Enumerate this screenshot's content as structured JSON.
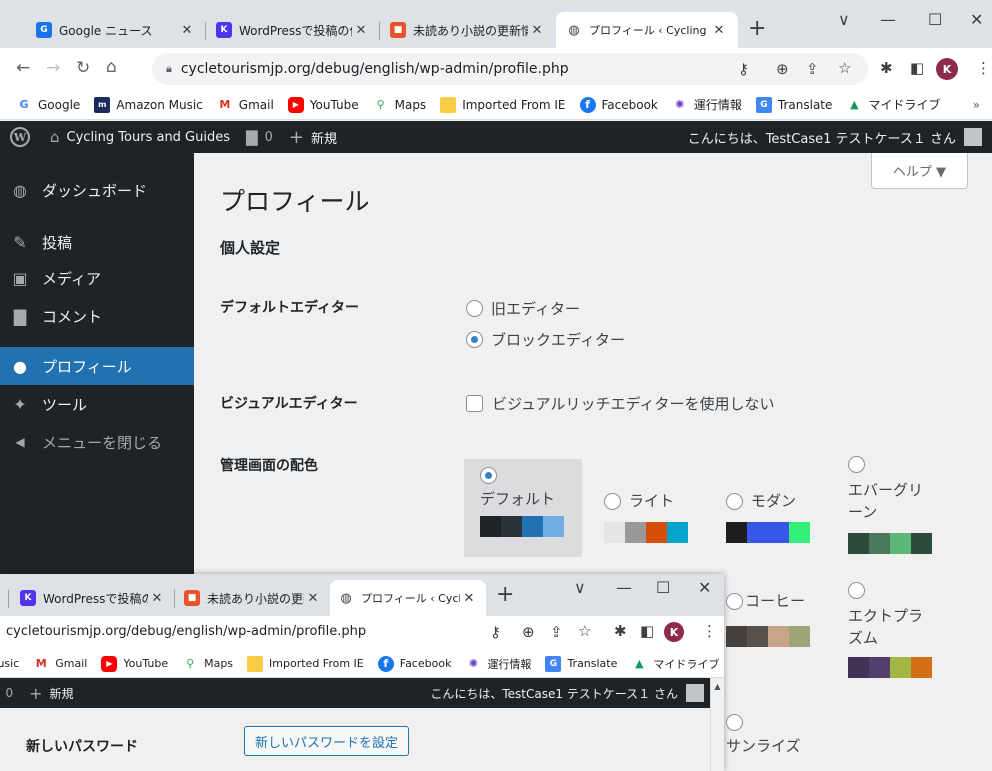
{
  "colors": {
    "brand_blue": "#2271b1",
    "admin_dark": "#1d2327",
    "tab_bg": "#dee1e6"
  },
  "browser": {
    "tabs": [
      {
        "label": "Google ニュース",
        "icon": "google-news-icon",
        "color": "#1a73e8"
      },
      {
        "label": "WordPressで投稿の作",
        "icon": "kinsta-icon",
        "color": "#5333ed"
      },
      {
        "label": "未読あり小説の更新情",
        "icon": "novel-icon",
        "color": "#e8532a"
      },
      {
        "label": "プロフィール ‹ Cycling To",
        "icon": "globe-icon",
        "color": "#3c4043"
      }
    ],
    "new_tab": "+",
    "controls": {
      "menu": "∨",
      "minimize": "—",
      "maximize": "☐",
      "close": "✕"
    },
    "url": "cycletourismjp.org/debug/english/wp-admin/profile.php",
    "profile_initial": "K",
    "bookmarks": [
      {
        "label": "Google",
        "icon": "google-icon",
        "color": "#4285f4"
      },
      {
        "label": "Amazon Music",
        "icon": "amazon-music-icon",
        "color": "#1c2a5e"
      },
      {
        "label": "Gmail",
        "icon": "gmail-icon",
        "color": "#d93025"
      },
      {
        "label": "YouTube",
        "icon": "youtube-icon",
        "color": "#ff0000"
      },
      {
        "label": "Maps",
        "icon": "maps-icon",
        "color": "#34a853"
      },
      {
        "label": "Imported From IE",
        "icon": "folder-icon",
        "color": "#f9cc45"
      },
      {
        "label": "Facebook",
        "icon": "facebook-icon",
        "color": "#1877f2"
      },
      {
        "label": "運行情報",
        "icon": "train-info-icon",
        "color": "#6a3fc8"
      },
      {
        "label": "Translate",
        "icon": "translate-icon",
        "color": "#4285f4"
      },
      {
        "label": "マイドライブ",
        "icon": "google-drive-icon",
        "color": "#0f9d58"
      }
    ],
    "overflow": "»"
  },
  "adminbar": {
    "site_name": "Cycling Tours and Guides",
    "comments_count": "0",
    "new_label": "新規",
    "howdy": "こんにちは、TestCase1 テストケース１ さん"
  },
  "sidebar": {
    "items": [
      {
        "label": "ダッシュボード",
        "icon": "dashboard-icon",
        "glyph": "◍"
      },
      {
        "label": "投稿",
        "icon": "pin-icon",
        "glyph": "✎"
      },
      {
        "label": "メディア",
        "icon": "media-icon",
        "glyph": "▣"
      },
      {
        "label": "コメント",
        "icon": "comment-icon",
        "glyph": "▇"
      },
      {
        "label": "プロフィール",
        "icon": "user-icon",
        "glyph": "●"
      },
      {
        "label": "ツール",
        "icon": "wrench-icon",
        "glyph": "✦"
      },
      {
        "label": "メニューを閉じる",
        "icon": "collapse-icon",
        "glyph": "◀"
      }
    ]
  },
  "main": {
    "title": "プロフィール",
    "help": "ヘルプ ▼",
    "section": "個人設定",
    "default_editor": {
      "label": "デフォルトエディター",
      "options": [
        "旧エディター",
        "ブロックエディター"
      ],
      "selected": "ブロックエディター"
    },
    "visual_editor": {
      "label": "ビジュアルエディター",
      "checkbox": "ビジュアルリッチエディターを使用しない"
    },
    "color_scheme": {
      "label": "管理画面の配色",
      "schemes": [
        {
          "name": "デフォルト",
          "colors": [
            "#1d2327",
            "#2c3338",
            "#2271b1",
            "#72aee6"
          ]
        },
        {
          "name": "ライト",
          "colors": [
            "#e5e5e5",
            "#999999",
            "#d64e07",
            "#04a4cc"
          ]
        },
        {
          "name": "モダン",
          "colors": [
            "#1e1e1e",
            "#3858e9",
            "#3858e9",
            "#33f078"
          ]
        },
        {
          "name": "エバーグリーン",
          "colors": [
            "#2c4c3b",
            "#4a7a5c",
            "#5db878",
            "#2c4c3b"
          ]
        },
        {
          "name": "コーヒー",
          "colors": [
            "#46403c",
            "#59524c",
            "#c7a589",
            "#9ea476"
          ]
        },
        {
          "name": "エクトプラズム",
          "colors": [
            "#413256",
            "#523f6d",
            "#a3b745",
            "#d46f15"
          ]
        },
        {
          "name": "サンライズ",
          "colors": [
            "#b43c38",
            "#cf4944",
            "#dd823b",
            "#ccaf0b"
          ]
        }
      ]
    },
    "new_password": {
      "label": "新しいパスワード",
      "button": "新しいパスワードを設定"
    }
  }
}
